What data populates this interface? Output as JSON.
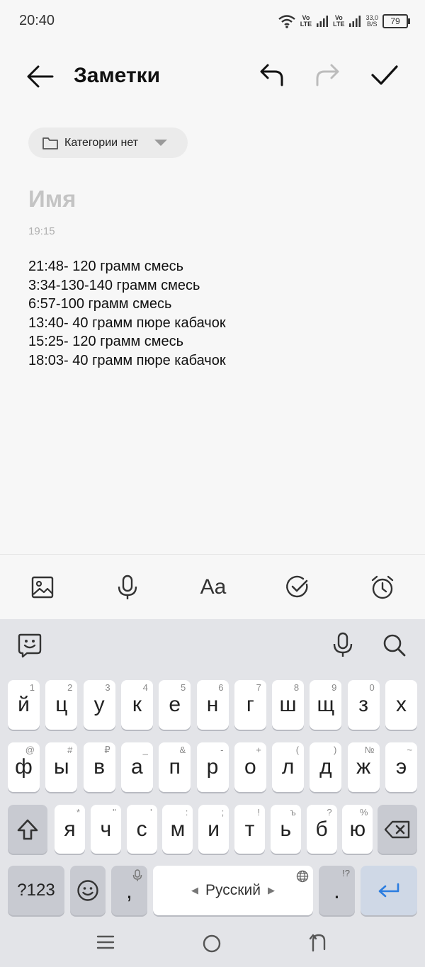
{
  "status": {
    "time": "20:40",
    "volte1": [
      "Vo",
      "LTE"
    ],
    "volte2": [
      "Vo",
      "LTE"
    ],
    "speed": [
      "33,0",
      "B/S"
    ],
    "battery": "79"
  },
  "header": {
    "title": "Заметки"
  },
  "category": {
    "label": "Категории нет"
  },
  "note": {
    "title_placeholder": "Имя",
    "time": "19:15",
    "lines": [
      "21:48- 120 грамм смесь",
      "3:34-130-140 грамм смесь",
      "6:57-100 грамм смесь",
      "13:40- 40 грамм пюре кабачок",
      "15:25- 120 грамм смесь",
      "18:03- 40 грамм пюре кабачок"
    ]
  },
  "toolbar": {
    "font_label": "Aa"
  },
  "keyboard": {
    "row1": [
      {
        "k": "й",
        "h": "1"
      },
      {
        "k": "ц",
        "h": "2"
      },
      {
        "k": "у",
        "h": "3"
      },
      {
        "k": "к",
        "h": "4"
      },
      {
        "k": "е",
        "h": "5"
      },
      {
        "k": "н",
        "h": "6"
      },
      {
        "k": "г",
        "h": "7"
      },
      {
        "k": "ш",
        "h": "8"
      },
      {
        "k": "щ",
        "h": "9"
      },
      {
        "k": "з",
        "h": "0"
      },
      {
        "k": "х",
        "h": ""
      }
    ],
    "row2": [
      {
        "k": "ф",
        "h": "@"
      },
      {
        "k": "ы",
        "h": "#"
      },
      {
        "k": "в",
        "h": "₽"
      },
      {
        "k": "а",
        "h": "_"
      },
      {
        "k": "п",
        "h": "&"
      },
      {
        "k": "р",
        "h": "-"
      },
      {
        "k": "о",
        "h": "+"
      },
      {
        "k": "л",
        "h": "("
      },
      {
        "k": "д",
        "h": ")"
      },
      {
        "k": "ж",
        "h": "№"
      },
      {
        "k": "э",
        "h": "~"
      }
    ],
    "row3": [
      {
        "k": "я",
        "h": "*"
      },
      {
        "k": "ч",
        "h": "\""
      },
      {
        "k": "с",
        "h": "'"
      },
      {
        "k": "м",
        "h": ":"
      },
      {
        "k": "и",
        "h": ";"
      },
      {
        "k": "т",
        "h": "!"
      },
      {
        "k": "ь",
        "h": "ъ"
      },
      {
        "k": "б",
        "h": "?"
      },
      {
        "k": "ю",
        "h": "%"
      }
    ],
    "symbols_label": "?123",
    "comma_label": ",",
    "space_label": "Русский",
    "period_label": ".",
    "period_hint": "!?"
  }
}
